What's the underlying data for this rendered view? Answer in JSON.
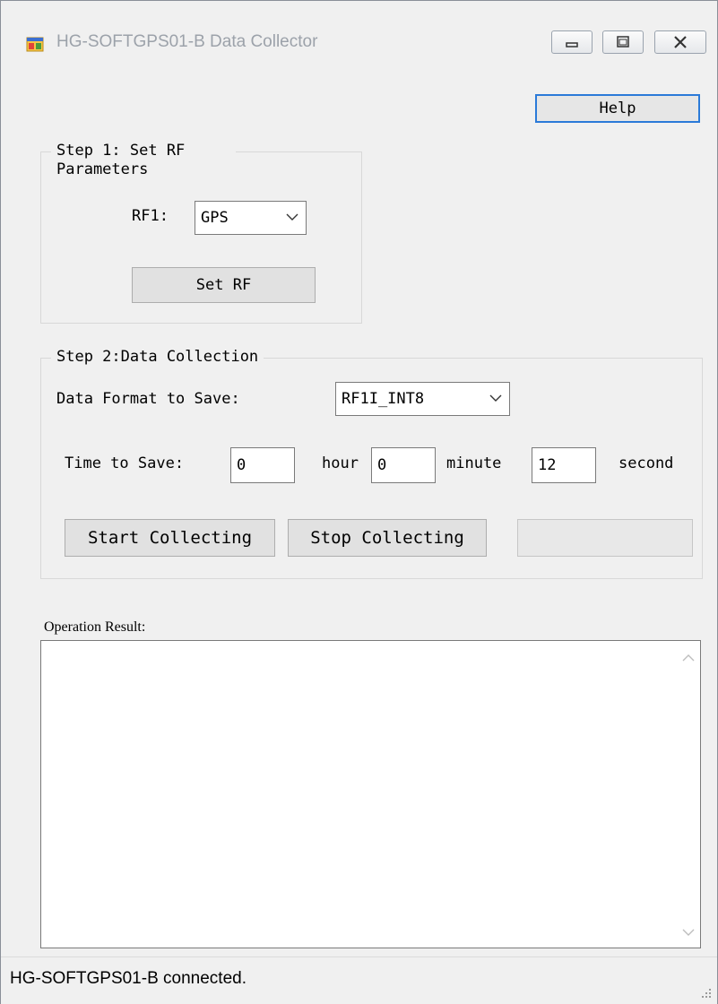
{
  "window": {
    "title": "HG-SOFTGPS01-B Data Collector",
    "icons": {
      "app": "app-window-icon",
      "minimize": "minimize-icon",
      "maximize": "maximize-icon",
      "close": "close-icon"
    }
  },
  "help_label": "Help",
  "step1": {
    "title": "Step 1: Set RF Parameters",
    "rf1_label": "RF1:",
    "rf1_value": "GPS",
    "set_rf_label": "Set RF"
  },
  "step2": {
    "title": "Step 2:Data Collection",
    "format_label": "Data Format to Save:",
    "format_value": "RF1I_INT8",
    "time_label": "Time to Save:",
    "hour_value": "0",
    "hour_unit": "hour",
    "minute_value": "0",
    "minute_unit": "minute",
    "second_value": "12",
    "second_unit": "second",
    "start_label": "Start Collecting",
    "stop_label": "Stop Collecting"
  },
  "result": {
    "label": "Operation Result:",
    "text": ""
  },
  "status": {
    "text": "HG-SOFTGPS01-B connected."
  }
}
